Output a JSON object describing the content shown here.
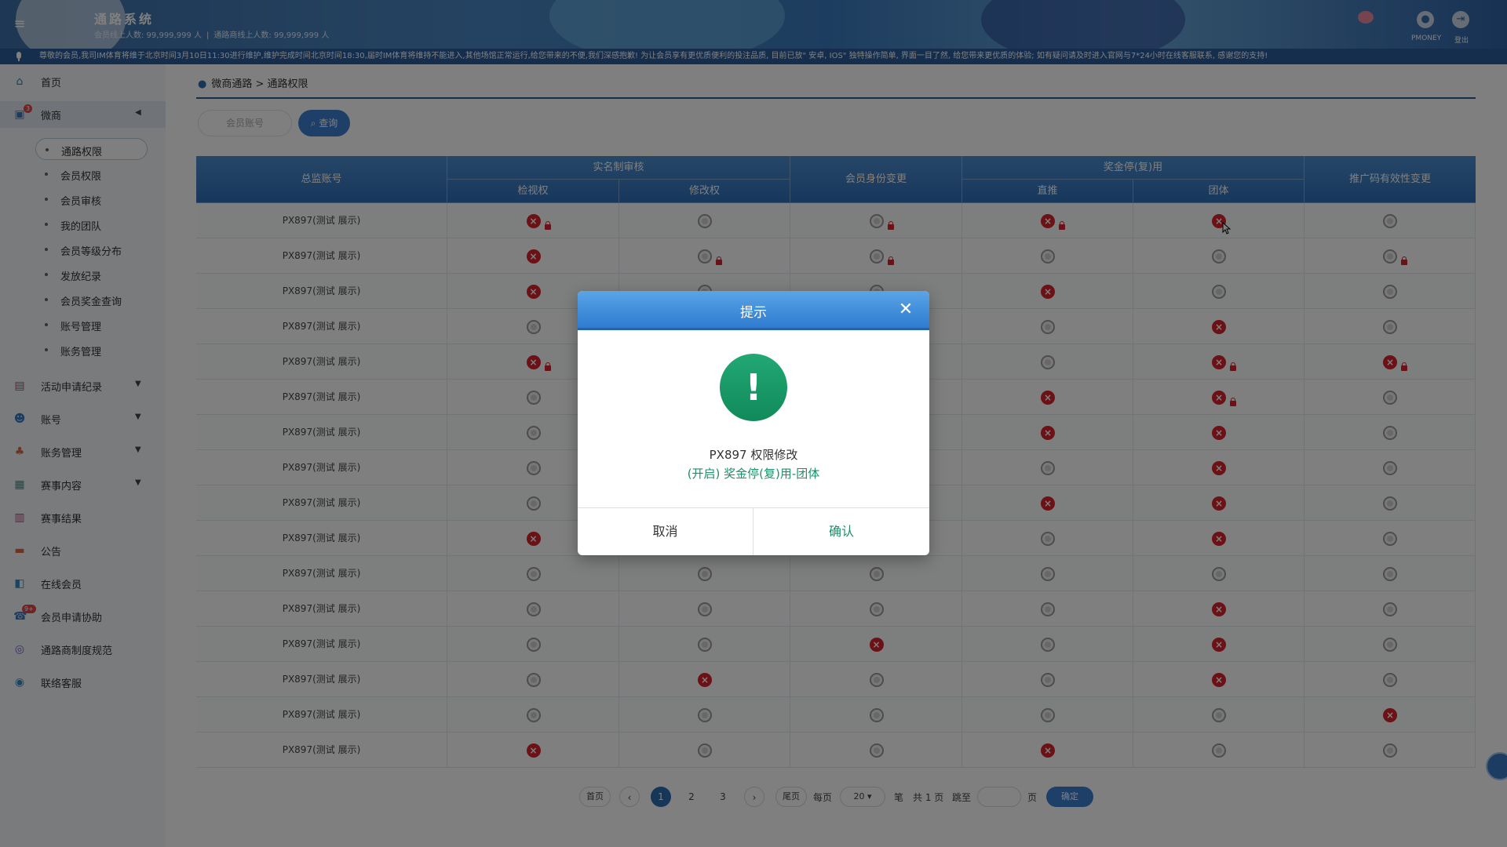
{
  "header": {
    "app_title": "通路系统",
    "online_members_label": "会员线上人数: 99,999,999 人",
    "online_channels_label": "通路商线上人数: 99,999,999 人",
    "user_label": "PMONEY",
    "logout_label": "登出"
  },
  "marquee": {
    "text": "尊敬的会员,我司IM体育将维于北京时间3月10日11:30进行维护,维护完成时间北京时间18:30,届时IM体育将维持不能进入,其他场馆正常运行,给您带来的不便,我们深感抱歉! 为让会员享有更优质便利的投注品质, 目前已放\" 安卓, IOS\" 独特操作简单, 界面一目了然, 给您带来更优质的体验; 如有疑问请及时进入官网与7*24小时在线客服联系, 感谢您的支持!"
  },
  "sidebar": {
    "items": [
      {
        "label": "首页",
        "icon": "home-icon"
      },
      {
        "label": "微商",
        "icon": "shop-icon",
        "badge": "3"
      },
      {
        "label": "活动申请纪录",
        "icon": "document-icon"
      },
      {
        "label": "账号",
        "icon": "user-icon"
      },
      {
        "label": "账务管理",
        "icon": "finance-icon"
      },
      {
        "label": "赛事内容",
        "icon": "event-icon"
      },
      {
        "label": "赛事结果",
        "icon": "result-icon"
      },
      {
        "label": "公告",
        "icon": "announcement-icon"
      },
      {
        "label": "在线会员",
        "icon": "online-icon"
      },
      {
        "label": "会员申请协助",
        "icon": "help-icon",
        "badge": "9+"
      },
      {
        "label": "通路商制度规范",
        "icon": "rules-icon"
      },
      {
        "label": "联络客服",
        "icon": "service-icon"
      }
    ],
    "sub_items": [
      "通路权限",
      "会员权限",
      "会员审核",
      "我的团队",
      "会员等级分布",
      "发放纪录",
      "会员奖金查询",
      "账号管理",
      "账务管理"
    ]
  },
  "breadcrumb": {
    "parent": "微商通路",
    "separator": ">",
    "current": "通路权限"
  },
  "search": {
    "placeholder": "会员账号",
    "button_label": "查询"
  },
  "table": {
    "headers": {
      "account": "总监账号",
      "realname_group": "实名制审核",
      "view": "检视权",
      "edit": "修改权",
      "identity": "会员身份变更",
      "bonus_group": "奖金停(复)用",
      "direct": "直推",
      "team": "团体",
      "promo": "推广码有效性变更"
    },
    "rows": [
      {
        "account": "PX897(测试 展示)",
        "states": [
          "off",
          "on",
          "on",
          "off",
          "off",
          "on"
        ],
        "locks": [
          1,
          0,
          1,
          1,
          0,
          0
        ]
      },
      {
        "account": "PX897(测试 展示)",
        "states": [
          "off",
          "on",
          "on",
          "on",
          "on",
          "on"
        ],
        "locks": [
          0,
          1,
          1,
          0,
          0,
          1
        ]
      },
      {
        "account": "PX897(测试 展示)",
        "states": [
          "off",
          "on",
          "on",
          "off",
          "on",
          "on"
        ],
        "locks": [
          0,
          0,
          0,
          0,
          0,
          0
        ]
      },
      {
        "account": "PX897(测试 展示)",
        "states": [
          "on",
          "on",
          "on",
          "on",
          "off",
          "on"
        ],
        "locks": [
          0,
          0,
          0,
          0,
          0,
          0
        ]
      },
      {
        "account": "PX897(测试 展示)",
        "states": [
          "off",
          "on",
          "on",
          "on",
          "off",
          "off"
        ],
        "locks": [
          1,
          0,
          0,
          0,
          1,
          1
        ]
      },
      {
        "account": "PX897(测试 展示)",
        "states": [
          "on",
          "on",
          "on",
          "off",
          "off",
          "on"
        ],
        "locks": [
          0,
          0,
          0,
          0,
          1,
          0
        ]
      },
      {
        "account": "PX897(测试 展示)",
        "states": [
          "on",
          "on",
          "on",
          "off",
          "off",
          "on"
        ],
        "locks": [
          0,
          0,
          0,
          0,
          0,
          0
        ]
      },
      {
        "account": "PX897(测试 展示)",
        "states": [
          "on",
          "on",
          "on",
          "on",
          "off",
          "on"
        ],
        "locks": [
          0,
          0,
          0,
          0,
          0,
          0
        ]
      },
      {
        "account": "PX897(测试 展示)",
        "states": [
          "on",
          "on",
          "on",
          "off",
          "off",
          "on"
        ],
        "locks": [
          0,
          0,
          0,
          0,
          0,
          0
        ]
      },
      {
        "account": "PX897(测试 展示)",
        "states": [
          "off",
          "on",
          "on",
          "on",
          "off",
          "on"
        ],
        "locks": [
          0,
          0,
          0,
          0,
          0,
          0
        ]
      },
      {
        "account": "PX897(测试 展示)",
        "states": [
          "on",
          "on",
          "on",
          "on",
          "on",
          "on"
        ],
        "locks": [
          0,
          0,
          0,
          0,
          0,
          0
        ]
      },
      {
        "account": "PX897(测试 展示)",
        "states": [
          "on",
          "on",
          "on",
          "on",
          "off",
          "on"
        ],
        "locks": [
          0,
          0,
          0,
          0,
          0,
          0
        ]
      },
      {
        "account": "PX897(测试 展示)",
        "states": [
          "on",
          "on",
          "off",
          "on",
          "off",
          "on"
        ],
        "locks": [
          0,
          0,
          0,
          0,
          0,
          0
        ]
      },
      {
        "account": "PX897(测试 展示)",
        "states": [
          "on",
          "off",
          "on",
          "on",
          "off",
          "on"
        ],
        "locks": [
          0,
          0,
          0,
          0,
          0,
          0
        ]
      },
      {
        "account": "PX897(测试 展示)",
        "states": [
          "on",
          "on",
          "on",
          "on",
          "on",
          "off"
        ],
        "locks": [
          0,
          0,
          0,
          0,
          0,
          0
        ]
      },
      {
        "account": "PX897(测试 展示)",
        "states": [
          "off",
          "on",
          "on",
          "off",
          "on",
          "on"
        ],
        "locks": [
          0,
          0,
          0,
          0,
          0,
          0
        ]
      }
    ]
  },
  "pagination": {
    "first": "首页",
    "last": "尾页",
    "pages": [
      "1",
      "2",
      "3"
    ],
    "current": "1",
    "per_page_label": "每页",
    "per_page_value": "20",
    "unit_label": "笔",
    "total_label": "共 1 页",
    "jump_label": "跳至",
    "page_label": "页",
    "confirm_label": "确定"
  },
  "dialog": {
    "title": "提示",
    "icon": "exclamation-icon",
    "message": "PX897 权限修改",
    "detail": "(开启) 奖金停(复)用-团体",
    "cancel_label": "取消",
    "confirm_label": "确认"
  },
  "colors": {
    "primary": "#2f6fb2",
    "success": "#1a9068",
    "danger": "#d9222a"
  }
}
